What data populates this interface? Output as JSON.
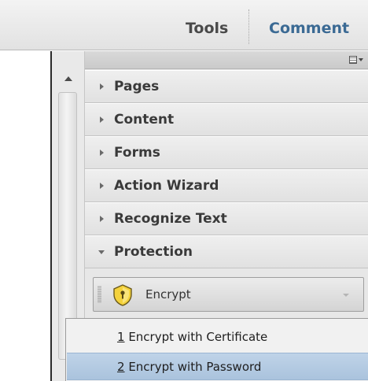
{
  "toolbar": {
    "tools_label": "Tools",
    "comment_label": "Comment"
  },
  "tools_pane": {
    "sections": [
      {
        "label": "Pages",
        "expanded": false
      },
      {
        "label": "Content",
        "expanded": false
      },
      {
        "label": "Forms",
        "expanded": false
      },
      {
        "label": "Action Wizard",
        "expanded": false
      },
      {
        "label": "Recognize Text",
        "expanded": false
      },
      {
        "label": "Protection",
        "expanded": true
      }
    ],
    "protection": {
      "encrypt_button_label": "Encrypt",
      "encrypt_icon": "shield-icon"
    }
  },
  "encrypt_menu": {
    "items": [
      {
        "num": "1",
        "label": " Encrypt with Certificate",
        "highlighted": false
      },
      {
        "num": "2",
        "label": " Encrypt with Password",
        "highlighted": true
      }
    ]
  },
  "colors": {
    "comment_accent": "#3b6a94",
    "highlight": "#b5cce3",
    "shield_yellow": "#f4d23c"
  }
}
